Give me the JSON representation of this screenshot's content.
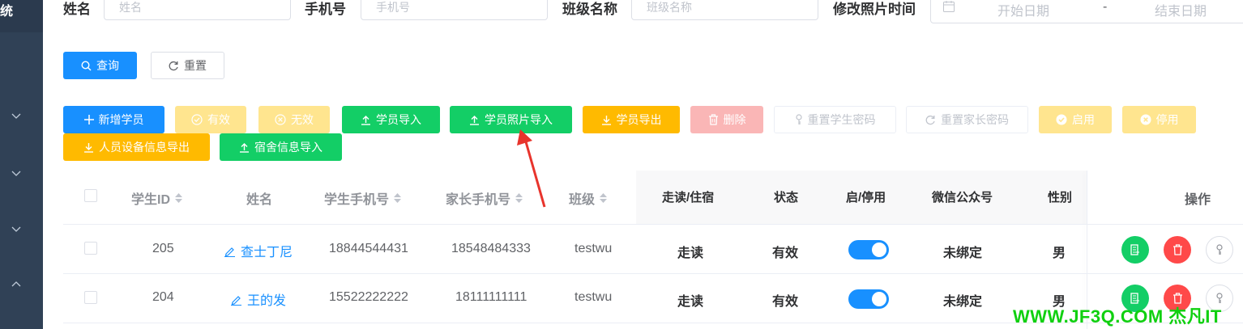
{
  "sidebar": {
    "title": "统",
    "items": [
      "chevron-down",
      "chevron-down",
      "chevron-down",
      "chevron-up"
    ]
  },
  "filters": {
    "name_label": "姓名",
    "name_placeholder": "姓名",
    "phone_label": "手机号",
    "phone_placeholder": "手机号",
    "class_label": "班级名称",
    "class_placeholder": "班级名称",
    "time_label": "修改照片时间",
    "start_placeholder": "开始日期",
    "separator": "-",
    "end_placeholder": "结束日期"
  },
  "search": {
    "query_label": "查询",
    "reset_label": "重置"
  },
  "toolbar": {
    "add": "新增学员",
    "valid": "有效",
    "invalid": "无效",
    "import": "学员导入",
    "photo_import": "学员照片导入",
    "export": "学员导出",
    "delete": "删除",
    "reset_student_pwd": "重置学生密码",
    "reset_parent_pwd": "重置家长密码",
    "enable": "启用",
    "disable": "停用",
    "device_export": "人员设备信息导出",
    "dorm_import": "宿舍信息导入"
  },
  "table": {
    "headers": {
      "id": "学生ID",
      "name": "姓名",
      "student_phone": "学生手机号",
      "parent_phone": "家长手机号",
      "class": "班级",
      "board": "走读/住宿",
      "status": "状态",
      "toggle": "启/停用",
      "wechat": "微信公众号",
      "gender": "性别",
      "actions": "操作"
    },
    "rows": [
      {
        "id": "205",
        "name": "查士丁尼",
        "student_phone": "18844544431",
        "parent_phone": "18548484333",
        "class": "testwu",
        "board": "走读",
        "status": "有效",
        "enabled": true,
        "wechat": "未绑定",
        "gender": "男"
      },
      {
        "id": "204",
        "name": "王的发",
        "student_phone": "15522222222",
        "parent_phone": "18111111111",
        "class": "testwu",
        "board": "走读",
        "status": "有效",
        "enabled": true,
        "wechat": "未绑定",
        "gender": "男"
      }
    ]
  },
  "watermark": "WWW.JF3Q.COM 杰凡IT",
  "colors": {
    "primary": "#1890ff",
    "success": "#13ce66",
    "warning": "#ffba00",
    "danger": "#ff4949",
    "annotation_arrow": "#e8342c"
  }
}
